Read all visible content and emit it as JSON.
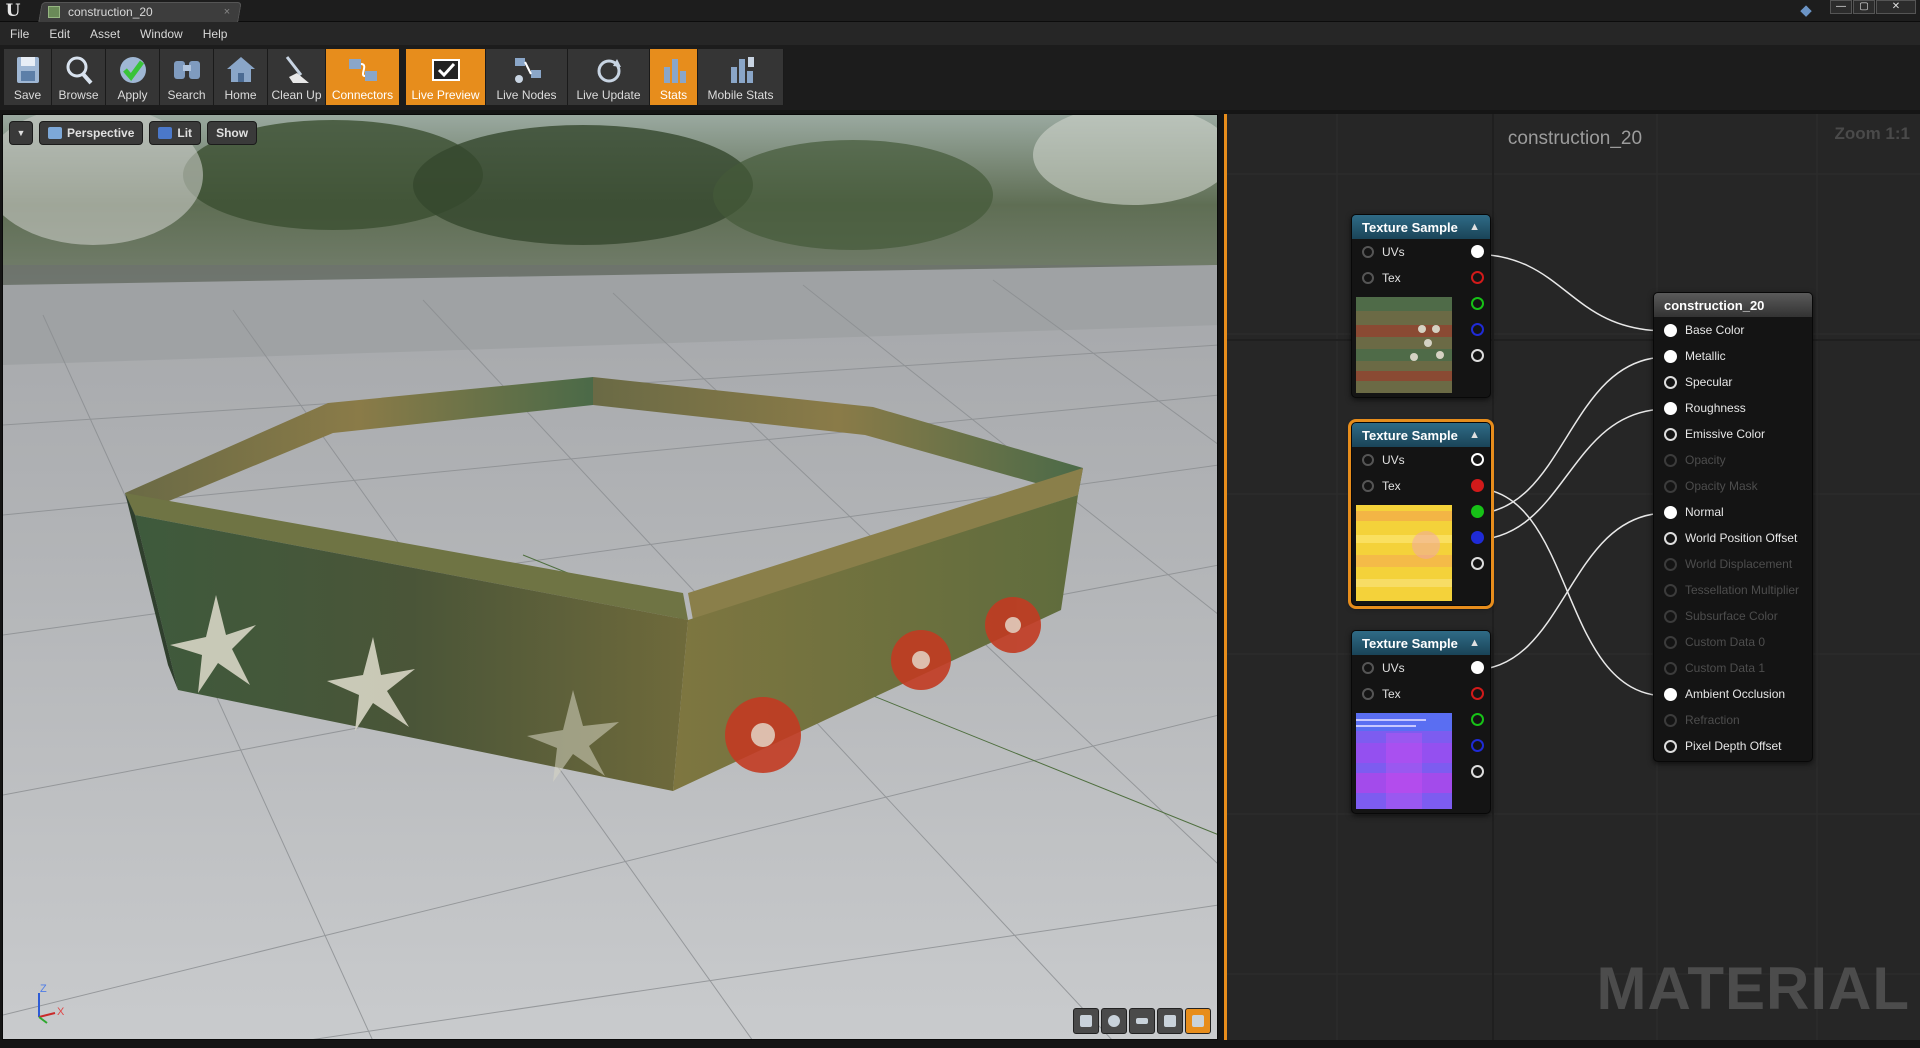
{
  "window": {
    "tab_title": "construction_20",
    "tab_close": "×",
    "controls": {
      "minimize": "—",
      "maximize": "▢",
      "close": "✕"
    }
  },
  "menu": [
    "File",
    "Edit",
    "Asset",
    "Window",
    "Help"
  ],
  "toolbar": {
    "buttons": [
      {
        "label": "Save",
        "icon": "save-icon",
        "active": false
      },
      {
        "label": "Browse",
        "icon": "browse-icon",
        "active": false
      },
      {
        "label": "Apply",
        "icon": "apply-icon",
        "active": false
      },
      {
        "label": "Search",
        "icon": "search-icon",
        "active": false
      },
      {
        "label": "Home",
        "icon": "home-icon",
        "active": false
      },
      {
        "label": "Clean Up",
        "icon": "clean-up-icon",
        "active": false
      },
      {
        "label": "Connectors",
        "icon": "connectors-icon",
        "active": true
      },
      {
        "label": "Live Preview",
        "icon": "live-preview-icon",
        "active": true
      },
      {
        "label": "Live Nodes",
        "icon": "live-nodes-icon",
        "active": false
      },
      {
        "label": "Live Update",
        "icon": "live-update-icon",
        "active": false
      },
      {
        "label": "Stats",
        "icon": "stats-icon",
        "active": true
      },
      {
        "label": "Mobile Stats",
        "icon": "mobile-stats-icon",
        "active": false
      }
    ]
  },
  "viewport": {
    "perspective_label": "Perspective",
    "lit_label": "Lit",
    "show_label": "Show",
    "axis": {
      "z": "Z",
      "x": "X"
    }
  },
  "graph": {
    "title": "construction_20",
    "zoom": "Zoom 1:1",
    "watermark": "MATERIAL",
    "texture_nodes": [
      {
        "title": "Texture Sample",
        "inputs": [
          "UVs",
          "Tex"
        ],
        "selected": false,
        "thumb": "texture-thumb-basecolor"
      },
      {
        "title": "Texture Sample",
        "inputs": [
          "UVs",
          "Tex"
        ],
        "selected": true,
        "thumb": "texture-thumb-mask"
      },
      {
        "title": "Texture Sample",
        "inputs": [
          "UVs",
          "Tex"
        ],
        "selected": false,
        "thumb": "texture-thumb-normal"
      }
    ],
    "material_node": {
      "title": "construction_20",
      "inputs": [
        {
          "label": "Base Color",
          "enabled": true,
          "connected": true
        },
        {
          "label": "Metallic",
          "enabled": true,
          "connected": true
        },
        {
          "label": "Specular",
          "enabled": true,
          "connected": false
        },
        {
          "label": "Roughness",
          "enabled": true,
          "connected": true
        },
        {
          "label": "Emissive Color",
          "enabled": true,
          "connected": false
        },
        {
          "label": "Opacity",
          "enabled": false,
          "connected": false
        },
        {
          "label": "Opacity Mask",
          "enabled": false,
          "connected": false
        },
        {
          "label": "Normal",
          "enabled": true,
          "connected": true
        },
        {
          "label": "World Position Offset",
          "enabled": true,
          "connected": false
        },
        {
          "label": "World Displacement",
          "enabled": false,
          "connected": false
        },
        {
          "label": "Tessellation Multiplier",
          "enabled": false,
          "connected": false
        },
        {
          "label": "Subsurface Color",
          "enabled": false,
          "connected": false
        },
        {
          "label": "Custom Data 0",
          "enabled": false,
          "connected": false
        },
        {
          "label": "Custom Data 1",
          "enabled": false,
          "connected": false
        },
        {
          "label": "Ambient Occlusion",
          "enabled": true,
          "connected": true
        },
        {
          "label": "Refraction",
          "enabled": false,
          "connected": false
        },
        {
          "label": "Pixel Depth Offset",
          "enabled": true,
          "connected": false
        }
      ]
    }
  },
  "colors": {
    "accent": "#e78d1c",
    "node_header": "#2f6b86",
    "pin_red": "#d11a1a",
    "pin_green": "#17c117",
    "pin_blue": "#1f2bd6"
  }
}
